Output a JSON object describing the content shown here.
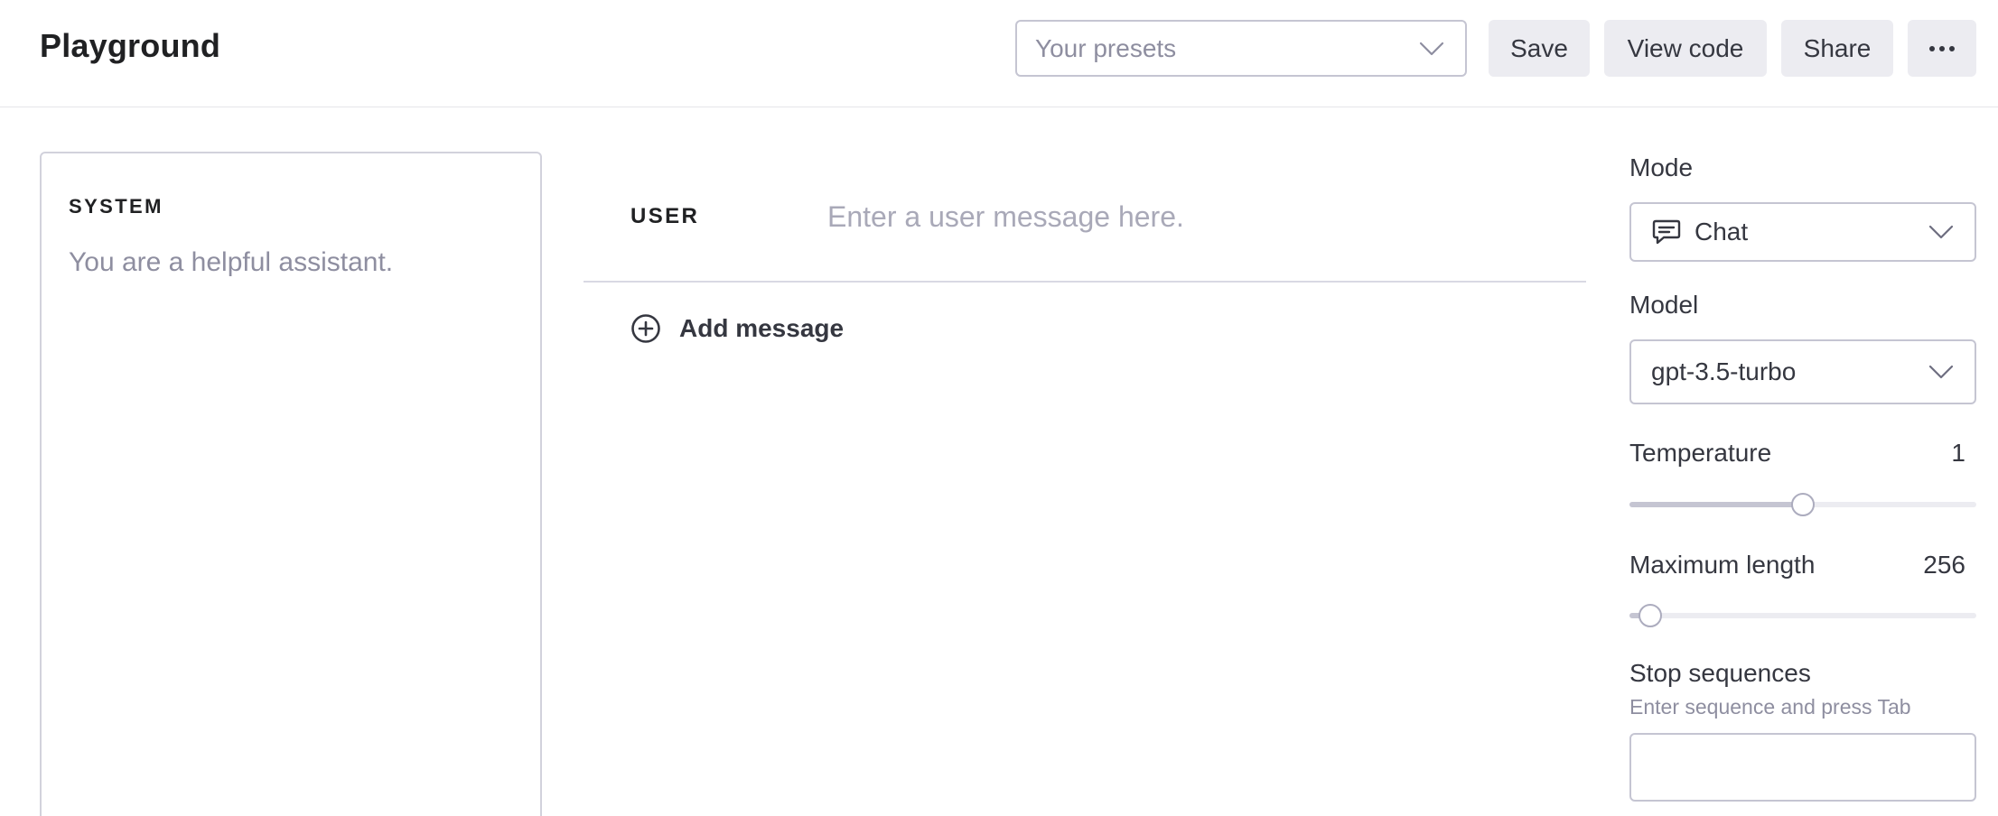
{
  "header": {
    "title": "Playground",
    "presets": {
      "placeholder": "Your presets"
    },
    "buttons": {
      "save": "Save",
      "view_code": "View code",
      "share": "Share"
    },
    "more_icon": "ellipsis-icon"
  },
  "system": {
    "label": "SYSTEM",
    "placeholder": "You are a helpful assistant."
  },
  "chat": {
    "user_label": "USER",
    "user_placeholder": "Enter a user message here.",
    "add_message": "Add message",
    "add_icon": "plus-circle-icon"
  },
  "sidebar": {
    "mode": {
      "label": "Mode",
      "value": "Chat",
      "icon": "chat-bubble-icon"
    },
    "model": {
      "label": "Model",
      "value": "gpt-3.5-turbo"
    },
    "temperature": {
      "label": "Temperature",
      "value": "1",
      "fraction": 0.5
    },
    "max_length": {
      "label": "Maximum length",
      "value": "256",
      "fraction": 0.06
    },
    "stop_sequences": {
      "label": "Stop sequences",
      "hint": "Enter sequence and press Tab"
    }
  }
}
